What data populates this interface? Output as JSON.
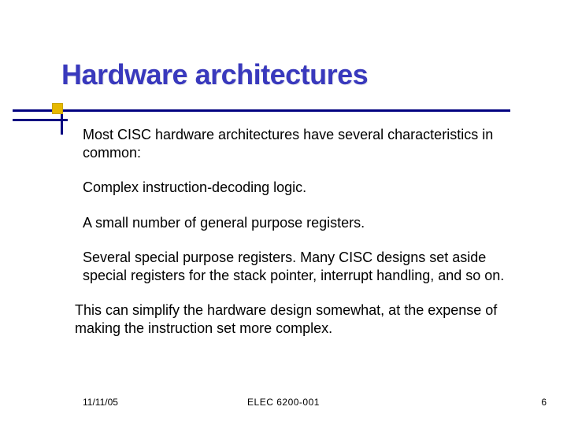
{
  "title": "Hardware architectures",
  "body": {
    "p1": "Most CISC hardware architectures have several characteristics in common:",
    "p2": "Complex instruction-decoding logic.",
    "p3": " A small number of general purpose registers.",
    "p4": " Several special purpose registers. Many CISC designs set aside special registers for the stack pointer, interrupt handling, and so on.",
    "p5": "This can simplify the hardware design somewhat, at the expense of making the instruction set more complex."
  },
  "footer": {
    "date": "11/11/05",
    "course": "ELEC 6200-001",
    "page": "6"
  },
  "colors": {
    "title": "#3939bd",
    "rule": "#000080",
    "accent": "#e6b800"
  }
}
